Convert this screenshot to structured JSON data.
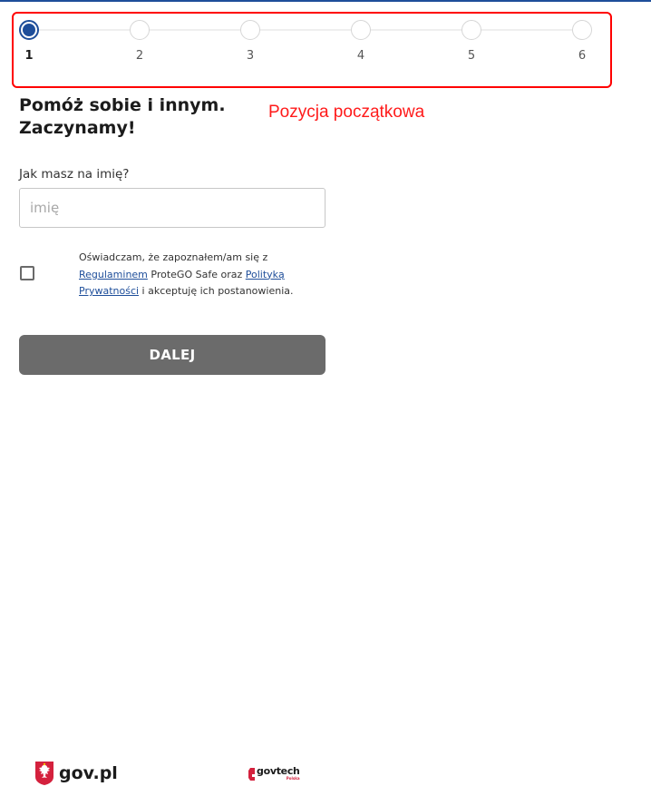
{
  "stepper": {
    "steps": [
      {
        "label": "1",
        "active": true
      },
      {
        "label": "2",
        "active": false
      },
      {
        "label": "3",
        "active": false
      },
      {
        "label": "4",
        "active": false
      },
      {
        "label": "5",
        "active": false
      },
      {
        "label": "6",
        "active": false
      }
    ],
    "active_color": "#1e4e9a"
  },
  "annotation": {
    "label": "Pozycja początkowa",
    "color": "#ff0000"
  },
  "form": {
    "heading": "Pomóż sobie i innym. Zaczynamy!",
    "name_label": "Jak masz na imię?",
    "name_placeholder": "imię",
    "name_value": "",
    "consent": {
      "checked": false,
      "text_before": "Oświadczam, że zapoznałem/am się z ",
      "link_terms": "Regulaminem",
      "text_middle": " ProteGO Safe oraz ",
      "link_privacy": "Polityką Prywatności",
      "text_after": " i akceptuję ich postanowienia."
    },
    "next_button_label": "DALEJ",
    "next_button_color": "#6b6b6b"
  },
  "footer": {
    "govpl_label": "gov.pl",
    "govtech_label": "govtech",
    "govtech_sub": "Polska",
    "govtech_color": "#d4213d"
  }
}
